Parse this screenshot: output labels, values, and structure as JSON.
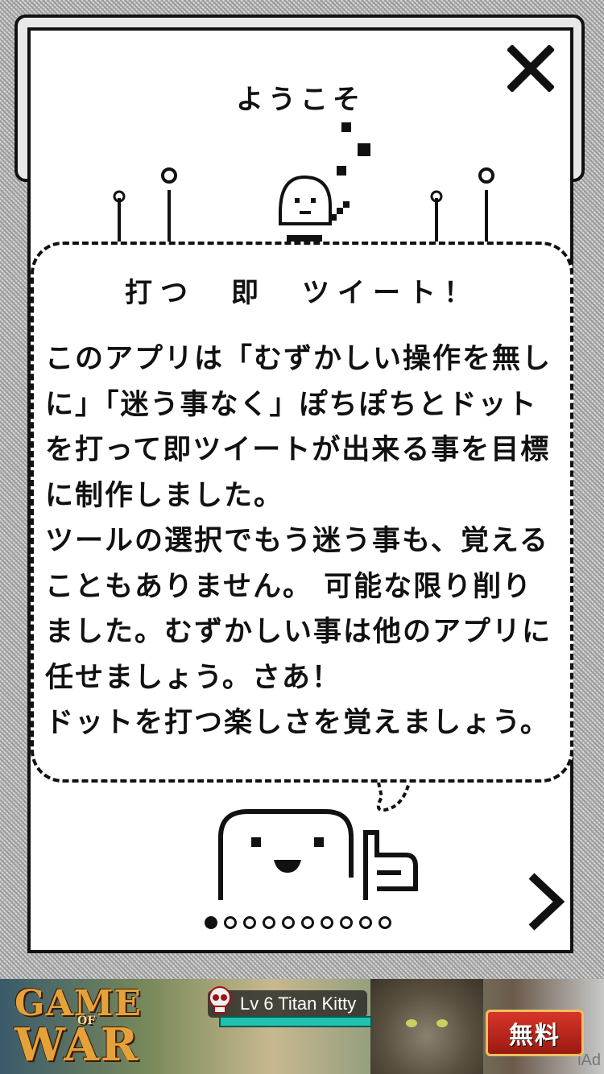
{
  "dialog": {
    "title": "ようこそ",
    "heading": "打つ　即　ツイート！",
    "body": "このアプリは「むずかしい操作を無しに」「迷う事なく」ぽちぽちとドットを打って即ツイートが出来る事を目標に制作しました。\nツールの選択でもう迷う事も、覚えることもありません。 可能な限り削りました。むずかしい事は他のアプリに任せましょう。さあ！\nドットを打つ楽しさを覚えましょう。"
  },
  "pager": {
    "total": 10,
    "current": 1
  },
  "icons": {
    "close": "close-icon",
    "next": "chevron-right-icon"
  },
  "ad": {
    "game_line1": "GAME",
    "game_of": "OF",
    "game_line2": "WAR",
    "level_label": "Lv 6 Titan Kitty",
    "cta_label": "無料",
    "badge": "iAd"
  }
}
